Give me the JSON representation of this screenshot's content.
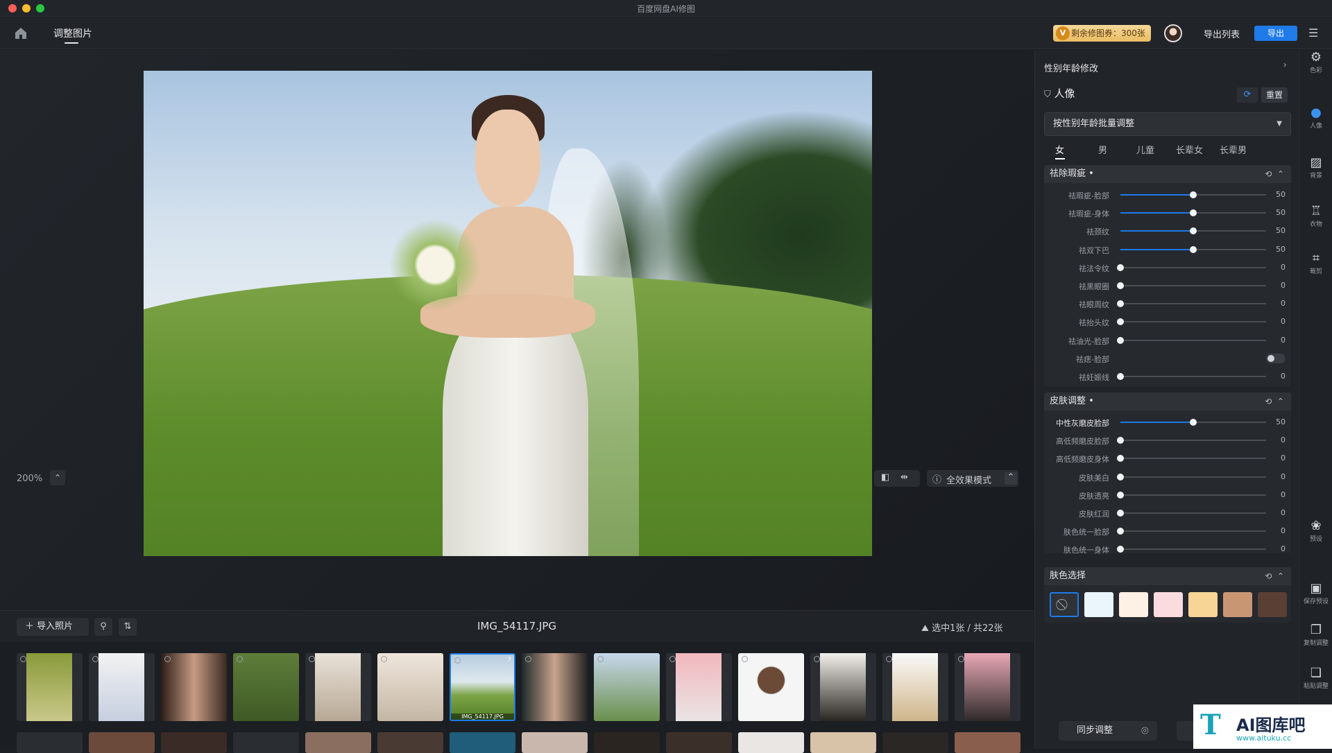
{
  "app": {
    "title": "百度网盘AI修图"
  },
  "topbar": {
    "tab_label": "调整图片",
    "coupon_text": "剩余修图券：300张",
    "export_list_label": "导出列表",
    "export_label": "导出",
    "menu_icon": "hamburger-icon"
  },
  "canvas": {
    "zoom_label": "200%",
    "mode_label": "全效果模式"
  },
  "filmbar": {
    "import_label": "＋ 导入照片",
    "filename": "IMG_54117.JPG",
    "selection_label": "选中1张 / 共22张"
  },
  "thumbs": {
    "selected_caption": "IMG_54117.JPG",
    "selected_badge": "7"
  },
  "panel": {
    "title": "性别年龄修改",
    "portrait_title": "人像",
    "reset_label": "重置",
    "batch_select_value": "按性别年龄批量调整",
    "gender_tabs": [
      "女",
      "男",
      "儿童",
      "长辈女",
      "长辈男"
    ],
    "sections": {
      "blemish": {
        "title": "祛除瑕疵 •",
        "rows": [
          {
            "label": "祛瑕疵-脸部",
            "value": "50",
            "level": 0.5
          },
          {
            "label": "祛瑕疵-身体",
            "value": "50",
            "level": 0.5
          },
          {
            "label": "祛颈纹",
            "value": "50",
            "level": 0.5
          },
          {
            "label": "祛双下巴",
            "value": "50",
            "level": 0.5
          },
          {
            "label": "祛法令纹",
            "value": "0",
            "level": 0
          },
          {
            "label": "祛黑眼圈",
            "value": "0",
            "level": 0
          },
          {
            "label": "祛眼周纹",
            "value": "0",
            "level": 0
          },
          {
            "label": "祛抬头纹",
            "value": "0",
            "level": 0
          },
          {
            "label": "祛油光-脸部",
            "value": "0",
            "level": 0
          },
          {
            "label": "祛痣-脸部",
            "value": "",
            "level": 0,
            "toggle": true
          },
          {
            "label": "祛妊娠线",
            "value": "0",
            "level": 0
          }
        ]
      },
      "skin": {
        "title": "皮肤调整 •",
        "rows": [
          {
            "label": "中性灰磨皮脸部",
            "value": "50",
            "level": 0.5
          },
          {
            "label": "高低频磨皮脸部",
            "value": "0",
            "level": 0
          },
          {
            "label": "高低频磨皮身体",
            "value": "0",
            "level": 0
          },
          {
            "label": "皮肤美白",
            "value": "0",
            "level": 0
          },
          {
            "label": "皮肤透亮",
            "value": "0",
            "level": 0
          },
          {
            "label": "皮肤红润",
            "value": "0",
            "level": 0
          },
          {
            "label": "肤色统一脸部",
            "value": "0",
            "level": 0
          },
          {
            "label": "肤色统一身体",
            "value": "0",
            "level": 0
          }
        ]
      },
      "skin_color": {
        "title": "肤色选择",
        "swatches": [
          "#eaf6fb",
          "#fdf0e4",
          "#f9dbe0",
          "#f6d596",
          "#c99674",
          "#5a3f34"
        ]
      }
    },
    "sync_label": "同步调整"
  },
  "rail": {
    "items": [
      {
        "label": "色彩",
        "icon": "sliders-icon"
      },
      {
        "label": "人像",
        "icon": "portrait-icon"
      },
      {
        "label": "背景",
        "icon": "background-icon"
      },
      {
        "label": "衣物",
        "icon": "shirt-icon"
      },
      {
        "label": "裁剪",
        "icon": "crop-icon"
      },
      {
        "label": "预设",
        "icon": "preset-icon"
      },
      {
        "label": "保存预设",
        "icon": "save-preset-icon"
      },
      {
        "label": "复制调整",
        "icon": "copy-icon"
      },
      {
        "label": "粘贴调整",
        "icon": "paste-icon"
      }
    ]
  },
  "watermark": {
    "brand": "AI图库吧",
    "url": "www.aituku.cc"
  }
}
